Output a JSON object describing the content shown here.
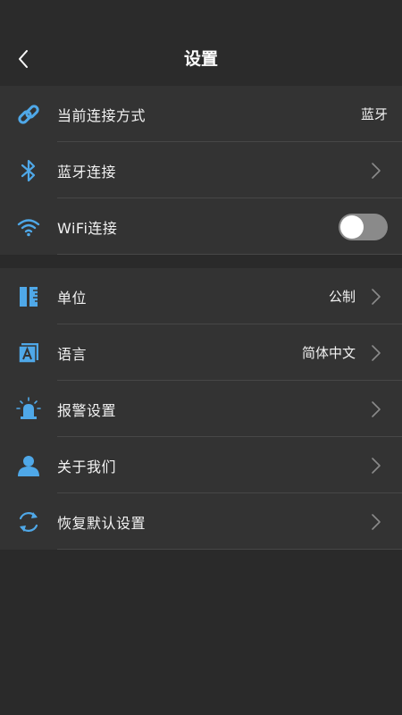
{
  "theme": {
    "background": "#2a2a2a",
    "group_background": "#333333",
    "accent": "#4fa8e8",
    "divider": "#474747",
    "toggle_off": "#8a8a8a"
  },
  "header": {
    "title": "设置",
    "back_icon": "chevron-left-icon"
  },
  "group1": [
    {
      "label": "当前连接方式",
      "value": "蓝牙",
      "icon": "link-icon",
      "chevron": false
    },
    {
      "label": "蓝牙连接",
      "value": "",
      "icon": "bluetooth-icon",
      "chevron": true
    },
    {
      "label": "WiFi连接",
      "value": "",
      "icon": "wifi-icon",
      "toggle": true,
      "toggle_on": false
    }
  ],
  "group2": [
    {
      "label": "单位",
      "value": "公制",
      "icon": "ruler-icon",
      "chevron": true
    },
    {
      "label": "语言",
      "value": "简体中文",
      "icon": "language-icon",
      "chevron": true
    },
    {
      "label": "报警设置",
      "value": "",
      "icon": "alarm-light-icon",
      "chevron": true
    },
    {
      "label": "关于我们",
      "value": "",
      "icon": "person-icon",
      "chevron": true
    },
    {
      "label": "恢复默认设置",
      "value": "",
      "icon": "reset-icon",
      "chevron": true
    }
  ]
}
